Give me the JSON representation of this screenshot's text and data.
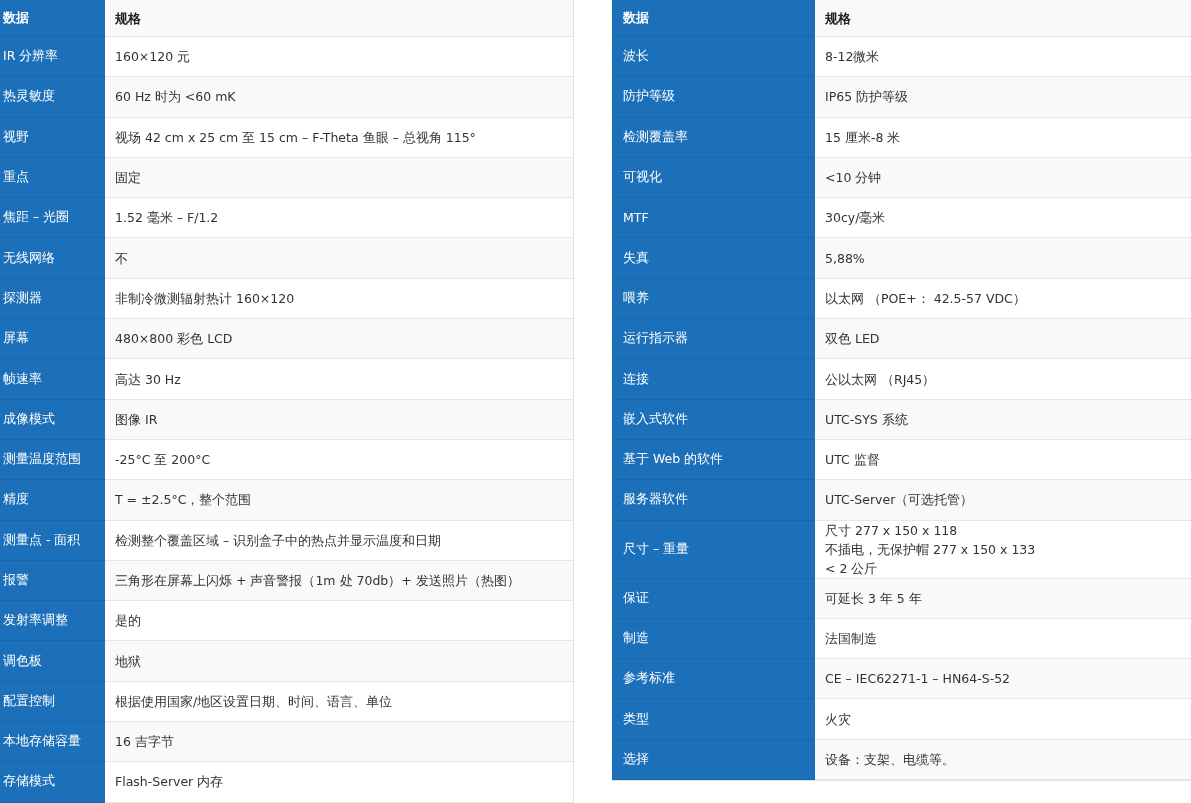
{
  "tables": [
    {
      "columns": [
        "数据",
        "规格"
      ],
      "rows": [
        {
          "label": "IR 分辨率",
          "value": "160×120 元"
        },
        {
          "label": "热灵敏度",
          "value": "60 Hz 时为 <60 mK"
        },
        {
          "label": "视野",
          "value": "视场 42 cm x 25 cm 至 15 cm – F-Theta 鱼眼 – 总视角 115°"
        },
        {
          "label": "重点",
          "value": "固定"
        },
        {
          "label": "焦距 – 光圈",
          "value": "1.52 毫米 – F/1.2"
        },
        {
          "label": "无线网络",
          "value": "不"
        },
        {
          "label": "探测器",
          "value": "非制冷微测辐射热计 160×120"
        },
        {
          "label": "屏幕",
          "value": "480×800 彩色 LCD"
        },
        {
          "label": "帧速率",
          "value": "高达 30 Hz"
        },
        {
          "label": "成像模式",
          "value": "图像 IR"
        },
        {
          "label": "测量温度范围",
          "value": "-25°C 至 200°C"
        },
        {
          "label": "精度",
          "value": "T = ±2.5°C，整个范围"
        },
        {
          "label": "测量点 - 面积",
          "value": "检测整个覆盖区域 – 识别盒子中的热点并显示温度和日期"
        },
        {
          "label": "报警",
          "value": "三角形在屏幕上闪烁 + 声音警报（1m 处 70db）+ 发送照片（热图）"
        },
        {
          "label": "发射率调整",
          "value": "是的"
        },
        {
          "label": "调色板",
          "value": "地狱"
        },
        {
          "label": "配置控制",
          "value": "根据使用国家/地区设置日期、时间、语言、单位"
        },
        {
          "label": "本地存储容量",
          "value": "16 吉字节"
        },
        {
          "label": "存储模式",
          "value": "Flash-Server 内存"
        }
      ]
    },
    {
      "columns": [
        "数据",
        "规格"
      ],
      "rows": [
        {
          "label": "波长",
          "value": "8-12微米"
        },
        {
          "label": "防护等级",
          "value": "IP65 防护等级"
        },
        {
          "label": "检测覆盖率",
          "value": "15 厘米-8 米"
        },
        {
          "label": "可视化",
          "value": "<10 分钟"
        },
        {
          "label": "MTF",
          "value": "30cy/毫米"
        },
        {
          "label": "失真",
          "value": "5,88%"
        },
        {
          "label": "喂养",
          "value": "以太网 （POE+： 42.5-57 VDC）"
        },
        {
          "label": "运行指示器",
          "value": "双色 LED"
        },
        {
          "label": "连接",
          "value": "公以太网 （RJ45）"
        },
        {
          "label": "嵌入式软件",
          "value": "UTC-SYS 系统"
        },
        {
          "label": "基于 Web 的软件",
          "value": "UTC 监督"
        },
        {
          "label": "服务器软件",
          "value": "UTC-Server（可选托管）"
        },
        {
          "label": "尺寸 – 重量",
          "value": "尺寸 277 x 150 x 118\n不插电，无保护帽 277 x 150 x 133\n< 2 公斤"
        },
        {
          "label": "保证",
          "value": "可延长 3 年 5 年"
        },
        {
          "label": "制造",
          "value": "法国制造"
        },
        {
          "label": "参考标准",
          "value": "CE – IEC62271-1 – HN64-S-52"
        },
        {
          "label": "类型",
          "value": "火灾"
        },
        {
          "label": "选择",
          "value": "设备：支架、电缆等。"
        }
      ]
    }
  ]
}
